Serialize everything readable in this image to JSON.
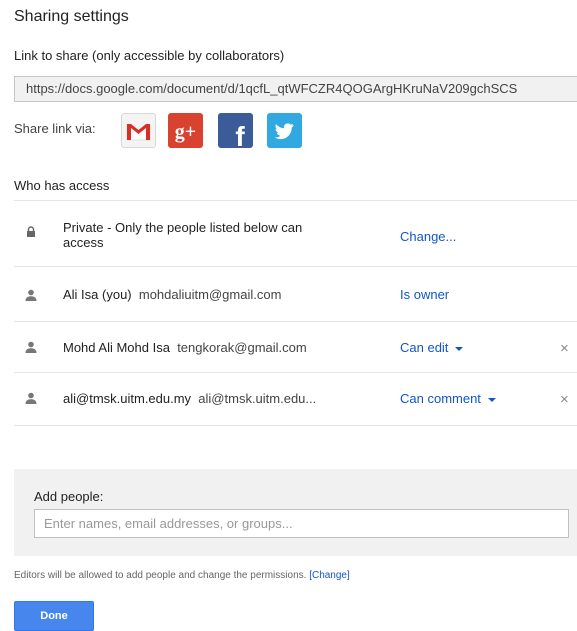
{
  "dialog": {
    "title": "Sharing settings",
    "link_label": "Link to share (only accessible by collaborators)",
    "link_value": "https://docs.google.com/document/d/1qcfL_qtWFCZR4QOGArgHKruNaV209gchSCS",
    "share_via_label": "Share link via:",
    "social_icons": [
      "gmail-icon",
      "google-plus-icon",
      "facebook-icon",
      "twitter-icon"
    ],
    "social_texts": {
      "gplus": "g+",
      "facebook": "f"
    },
    "who_has_access_label": "Who has access",
    "access_rows": [
      {
        "icon": "lock-icon",
        "line1": "Private - Only the people listed below can",
        "line2": "access",
        "action": "Change..."
      },
      {
        "icon": "person-icon",
        "name": "Ali Isa (you)",
        "email": "mohdaliuitm@gmail.com",
        "action": "Is owner"
      },
      {
        "icon": "person-icon",
        "name": "Mohd Ali Mohd Isa",
        "email": "tengkorak@gmail.com",
        "action": "Can edit",
        "remove": "×"
      },
      {
        "icon": "person-icon",
        "name": "ali@tmsk.uitm.edu.my",
        "email": "ali@tmsk.uitm.edu...",
        "action": "Can comment",
        "remove": "×"
      }
    ],
    "add_people": {
      "label": "Add people:",
      "placeholder": "Enter names, email addresses, or groups..."
    },
    "editors_note": "Editors will be allowed to add people and change the permissions.",
    "editors_change_link": "[Change]",
    "done_label": "Done",
    "colors": {
      "link": "#1155cc",
      "done_button": "#4787ed",
      "gplus": "#d8422e",
      "facebook": "#3b5b99",
      "twitter": "#2fa9e0"
    }
  }
}
